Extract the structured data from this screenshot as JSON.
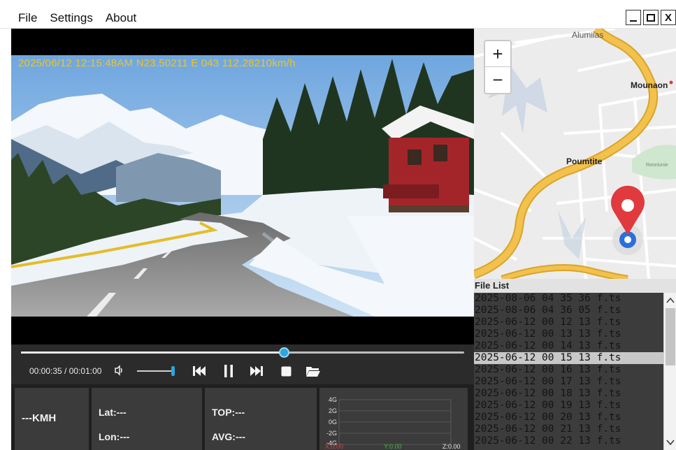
{
  "menu": {
    "file": "File",
    "settings": "Settings",
    "about": "About"
  },
  "window_buttons": {
    "close": "X"
  },
  "video": {
    "osd": "2025/06/12  12:15:48AM  N23.50211  E 043 112.28210km/h"
  },
  "playback": {
    "time": "00:00:35 / 00:01:00",
    "progress": 0.593,
    "volume": 0.95
  },
  "stats": {
    "speed": "---KMH",
    "lat": "Lat:---",
    "lon": "Lon:---",
    "top": "TOP:---",
    "avg": "AVG:---",
    "gsensor": {
      "ticks": [
        "4G",
        "2G",
        "0G",
        "-2G",
        "-4G"
      ],
      "x": "X:0.00",
      "y": "Y:0.00",
      "z": "Z:0.00",
      "colors": {
        "x": "#e04040",
        "y": "#40c040",
        "z": "#e6e6e6"
      }
    }
  },
  "map": {
    "zoom_in": "+",
    "zoom_out": "−",
    "labels": {
      "top": "Alumiias",
      "right": "Mounaon",
      "center": "Poumtite",
      "park": "Ronniunie"
    },
    "colors": {
      "road": "#f2c14e",
      "pin": "#e03a3e",
      "location": "#2a6fdb"
    }
  },
  "file_list": {
    "header": "File List",
    "selected_index": 5,
    "items": [
      "2025-08-06 04 35 36 f.ts",
      "2025-08-06 04 36 05 f.ts",
      "2025-06-12 00 12 13 f.ts",
      "2025-06-12 00 13 13 f.ts",
      "2025-06-12 00 14 13 f.ts",
      "2025-06-12 00 15 13 f.ts",
      "2025-06-12 00 16 13 f.ts",
      "2025-06-12 00 17 13 f.ts",
      "2025-06-12 00 18 13 f.ts",
      "2025-06-12 00 19 13 f.ts",
      "2025-06-12 00 20 13 f.ts",
      "2025-06-12 00 21 13 f.ts",
      "2025-06-12 00 22 13 f.ts"
    ]
  }
}
